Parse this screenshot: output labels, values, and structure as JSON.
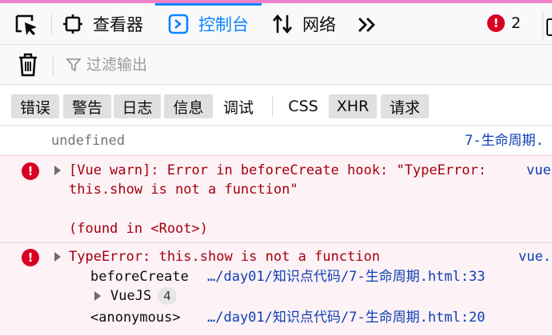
{
  "toolbar": {
    "tabs": [
      {
        "label": "查看器",
        "icon": "inspector-icon"
      },
      {
        "label": "控制台",
        "icon": "console-icon"
      },
      {
        "label": "网络",
        "icon": "network-icon"
      }
    ],
    "more_icon": "chevrons-right-icon",
    "error_count": "2",
    "selected_tab": "控制台"
  },
  "filter": {
    "placeholder": "过滤输出"
  },
  "levels": [
    {
      "label": "错误",
      "active": true
    },
    {
      "label": "警告",
      "active": true
    },
    {
      "label": "日志",
      "active": true
    },
    {
      "label": "信息",
      "active": true
    },
    {
      "label": "调试",
      "active": false
    },
    {
      "label": "CSS",
      "active": false
    },
    {
      "label": "XHR",
      "active": true
    },
    {
      "label": "请求",
      "active": true
    }
  ],
  "console": {
    "log": {
      "text": "undefined",
      "source": "7-生命周期."
    },
    "error1": {
      "line1": "[Vue warn]: Error in beforeCreate hook: \"TypeError:",
      "line2": "this.show is not a function\"",
      "line3": "(found in <Root>)",
      "source": "vue"
    },
    "error2": {
      "message": "TypeError: this.show is not a function",
      "source": "vue.",
      "stack": [
        {
          "fn": "beforeCreate",
          "location": "…/day01/知识点代码/7-生命周期.html:33"
        },
        {
          "fn": "VueJS",
          "count": "4"
        },
        {
          "fn": "<anonymous>",
          "location": "…/day01/知识点代码/7-生命周期.html:20"
        }
      ]
    }
  },
  "colors": {
    "accent": "#0a84ff",
    "error": "#d70022",
    "error_bg": "#fdf2f5",
    "error_text": "#a4000f"
  }
}
